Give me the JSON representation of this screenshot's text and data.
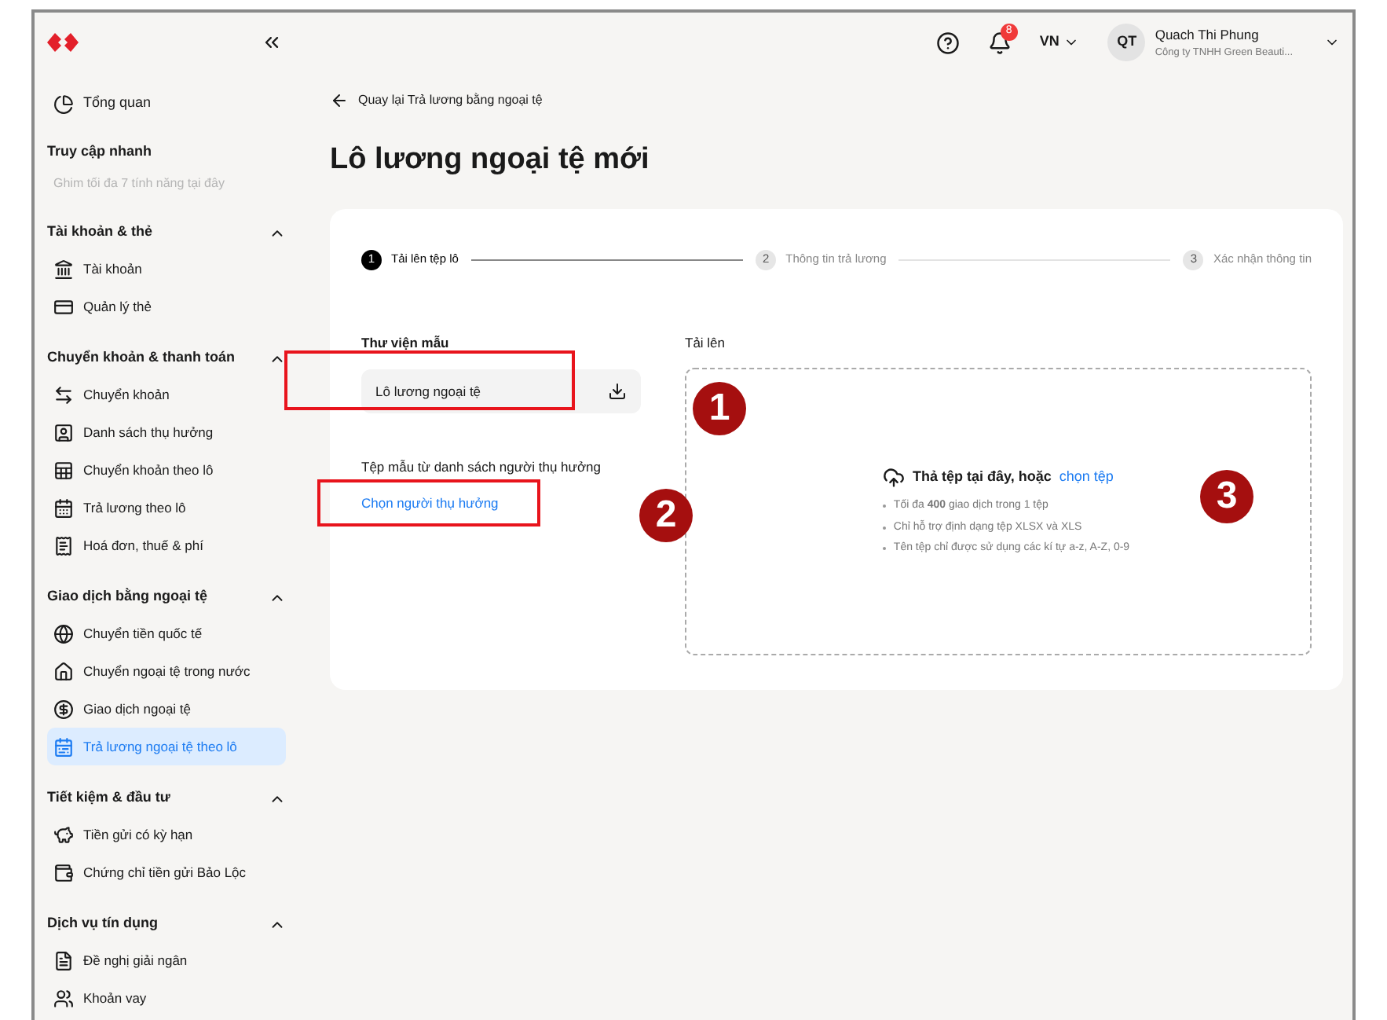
{
  "sidebar": {
    "top_item": {
      "label": "Tổng quan"
    },
    "quick_access": {
      "title": "Truy cập nhanh",
      "hint": "Ghim tối đa 7 tính năng tại đây"
    },
    "sections": [
      {
        "title": "Tài khoản & thẻ",
        "expanded": true,
        "items": [
          {
            "label": "Tài khoản",
            "selected": false
          },
          {
            "label": "Quản lý thẻ",
            "selected": false
          }
        ]
      },
      {
        "title": "Chuyển khoản & thanh toán",
        "expanded": true,
        "items": [
          {
            "label": "Chuyển khoản",
            "selected": false
          },
          {
            "label": "Danh sách thụ hưởng",
            "selected": false
          },
          {
            "label": "Chuyển khoản theo lô",
            "selected": false
          },
          {
            "label": "Trả lương theo lô",
            "selected": false
          },
          {
            "label": "Hoá đơn, thuế & phí",
            "selected": false
          }
        ]
      },
      {
        "title": "Giao dịch bằng ngoại tệ",
        "expanded": true,
        "items": [
          {
            "label": "Chuyển tiền quốc tế",
            "selected": false
          },
          {
            "label": "Chuyển ngoại tệ trong nước",
            "selected": false
          },
          {
            "label": "Giao dịch ngoại tệ",
            "selected": false
          },
          {
            "label": "Trả lương ngoại tệ theo lô",
            "selected": true
          }
        ]
      },
      {
        "title": "Tiết kiệm & đầu tư",
        "expanded": true,
        "items": [
          {
            "label": "Tiền gửi có kỳ hạn",
            "selected": false
          },
          {
            "label": "Chứng chỉ tiền gửi Bảo Lộc",
            "selected": false
          }
        ]
      },
      {
        "title": "Dịch vụ tín dụng",
        "expanded": true,
        "items": [
          {
            "label": "Đề nghị giải ngân",
            "selected": false
          },
          {
            "label": "Khoản vay",
            "selected": false
          }
        ]
      }
    ]
  },
  "header": {
    "notification_count": "8",
    "language": "VN",
    "avatar": "QT",
    "user_name": "Quach Thi Phung",
    "company": "Công ty TNHH Green Beauti..."
  },
  "back_link": "Quay lại Trả lương bằng ngoại tệ",
  "title": "Lô lương ngoại tệ mới",
  "steps": [
    {
      "number": "1",
      "label": "Tải lên tệp lô",
      "selected": true
    },
    {
      "number": "2",
      "label": "Thông tin trả lương",
      "selected": false
    },
    {
      "number": "3",
      "label": "Xác nhận thông tin",
      "selected": false
    }
  ],
  "template": {
    "title": "Thư viện mẫu",
    "value": "Lô lương ngoại tệ",
    "beneficiary_title": "Tệp mẫu từ danh sách người thụ hưởng",
    "beneficiary_link": "Chọn người thụ hưởng"
  },
  "upload": {
    "title": "Tải lên",
    "drop_text": "Thả tệp tại đây, hoặc",
    "link": "chọn tệp",
    "rules": [
      "Tối đa **400** giao dịch trong 1 tệp",
      "Chỉ hỗ trợ định dạng tệp XLSX và XLS",
      "Tên tệp chỉ được sử dụng các kí tự a-z, A-Z, 0-9"
    ]
  },
  "annotations": {
    "markers": [
      "1",
      "2",
      "3"
    ]
  }
}
